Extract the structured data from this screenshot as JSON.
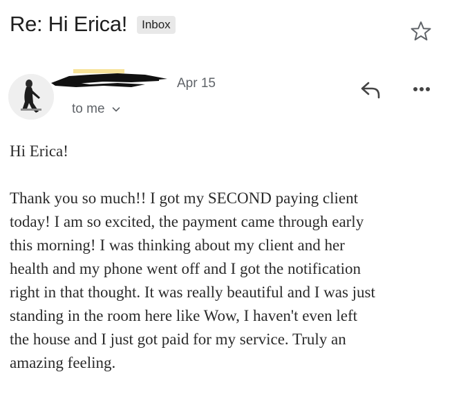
{
  "email": {
    "subject": "Re: Hi Erica!",
    "label": "Inbox",
    "date": "Apr 15",
    "recipient": "to me",
    "greeting": "Hi Erica!",
    "body_lines": [
      "Thank you so much!! I got my SECOND paying client",
      "today! I am so excited, the payment came through early",
      "this morning! I was thinking about my client and her",
      "health and my phone went off and I got the notification",
      "right in that thought. It was really beautiful and I was just",
      "standing in the room here like Wow, I haven't even left",
      "the house and I just got paid for my service. Truly an",
      "amazing feeling."
    ]
  },
  "icons": {
    "star": "star-outline-icon",
    "reply": "reply-arrow-icon",
    "more": "more-horizontal-icon",
    "chevron": "chevron-down-icon"
  },
  "colors": {
    "text": "#202124",
    "secondary": "#5f6368",
    "chip_bg": "#e8e8e8",
    "redaction": "#111111",
    "redaction_highlight": "#f7e39a"
  }
}
